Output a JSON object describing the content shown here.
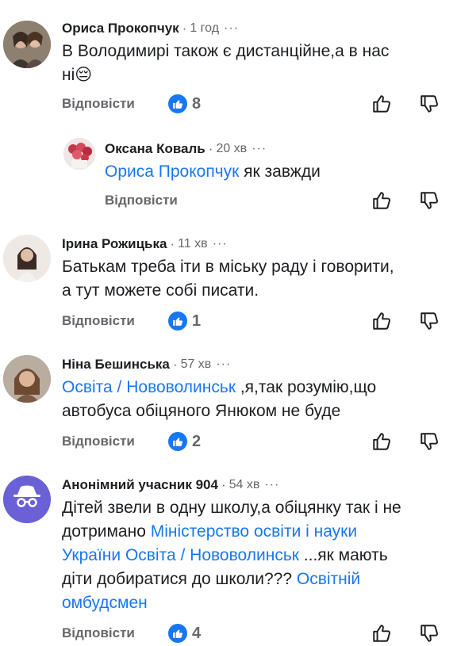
{
  "comments": [
    {
      "author": "Ориса Прокопчук",
      "time": "1 год",
      "text_lines": [
        "В Володимирі також є дистанційне,а в нас",
        "ні😔"
      ],
      "reply_label": "Відповісти",
      "like_count": "8"
    },
    {
      "author": "Оксана Коваль",
      "time": "20 хв",
      "mention": "Ориса Прокопчук",
      "text": " як завжди",
      "reply_label": "Відповісти"
    },
    {
      "author": "Ірина Рожицька",
      "time": "11 хв",
      "text_lines": [
        "Батькам треба іти в міську раду і говорити,",
        "а тут можете собі писати."
      ],
      "reply_label": "Відповісти",
      "like_count": "1"
    },
    {
      "author": "Ніна Бешинська",
      "time": "57 хв",
      "mention": "Освіта / Нововолинськ",
      "text_after_mention": " ,я,так розумію,що",
      "text_line2": "автобуса обіцяного Янюком не буде",
      "reply_label": "Відповісти",
      "like_count": "2"
    },
    {
      "author": "Анонімний учасник 904",
      "time": "54 хв",
      "line1": "Дітей звели в одну школу,а обіцянку так і не",
      "line2_text": "дотримано ",
      "line2_mention": "Міністерство освіти і науки",
      "line3_mention": "України Освіта / Нововолинськ",
      "line3_text": " ...як мають",
      "line4_text": "діти добиратися до школи??? ",
      "line4_mention": "Освітній",
      "line5_mention": "омбудсмен",
      "reply_label": "Відповісти",
      "like_count": "4"
    }
  ],
  "separator": "·",
  "dots": "···",
  "colors": {
    "link": "#1877f2",
    "muted": "#65676b",
    "like": "#1877f2"
  },
  "icons": [
    "thumbs-up-icon",
    "thumbs-down-icon",
    "like-badge-icon",
    "anonymous-avatar-icon"
  ]
}
